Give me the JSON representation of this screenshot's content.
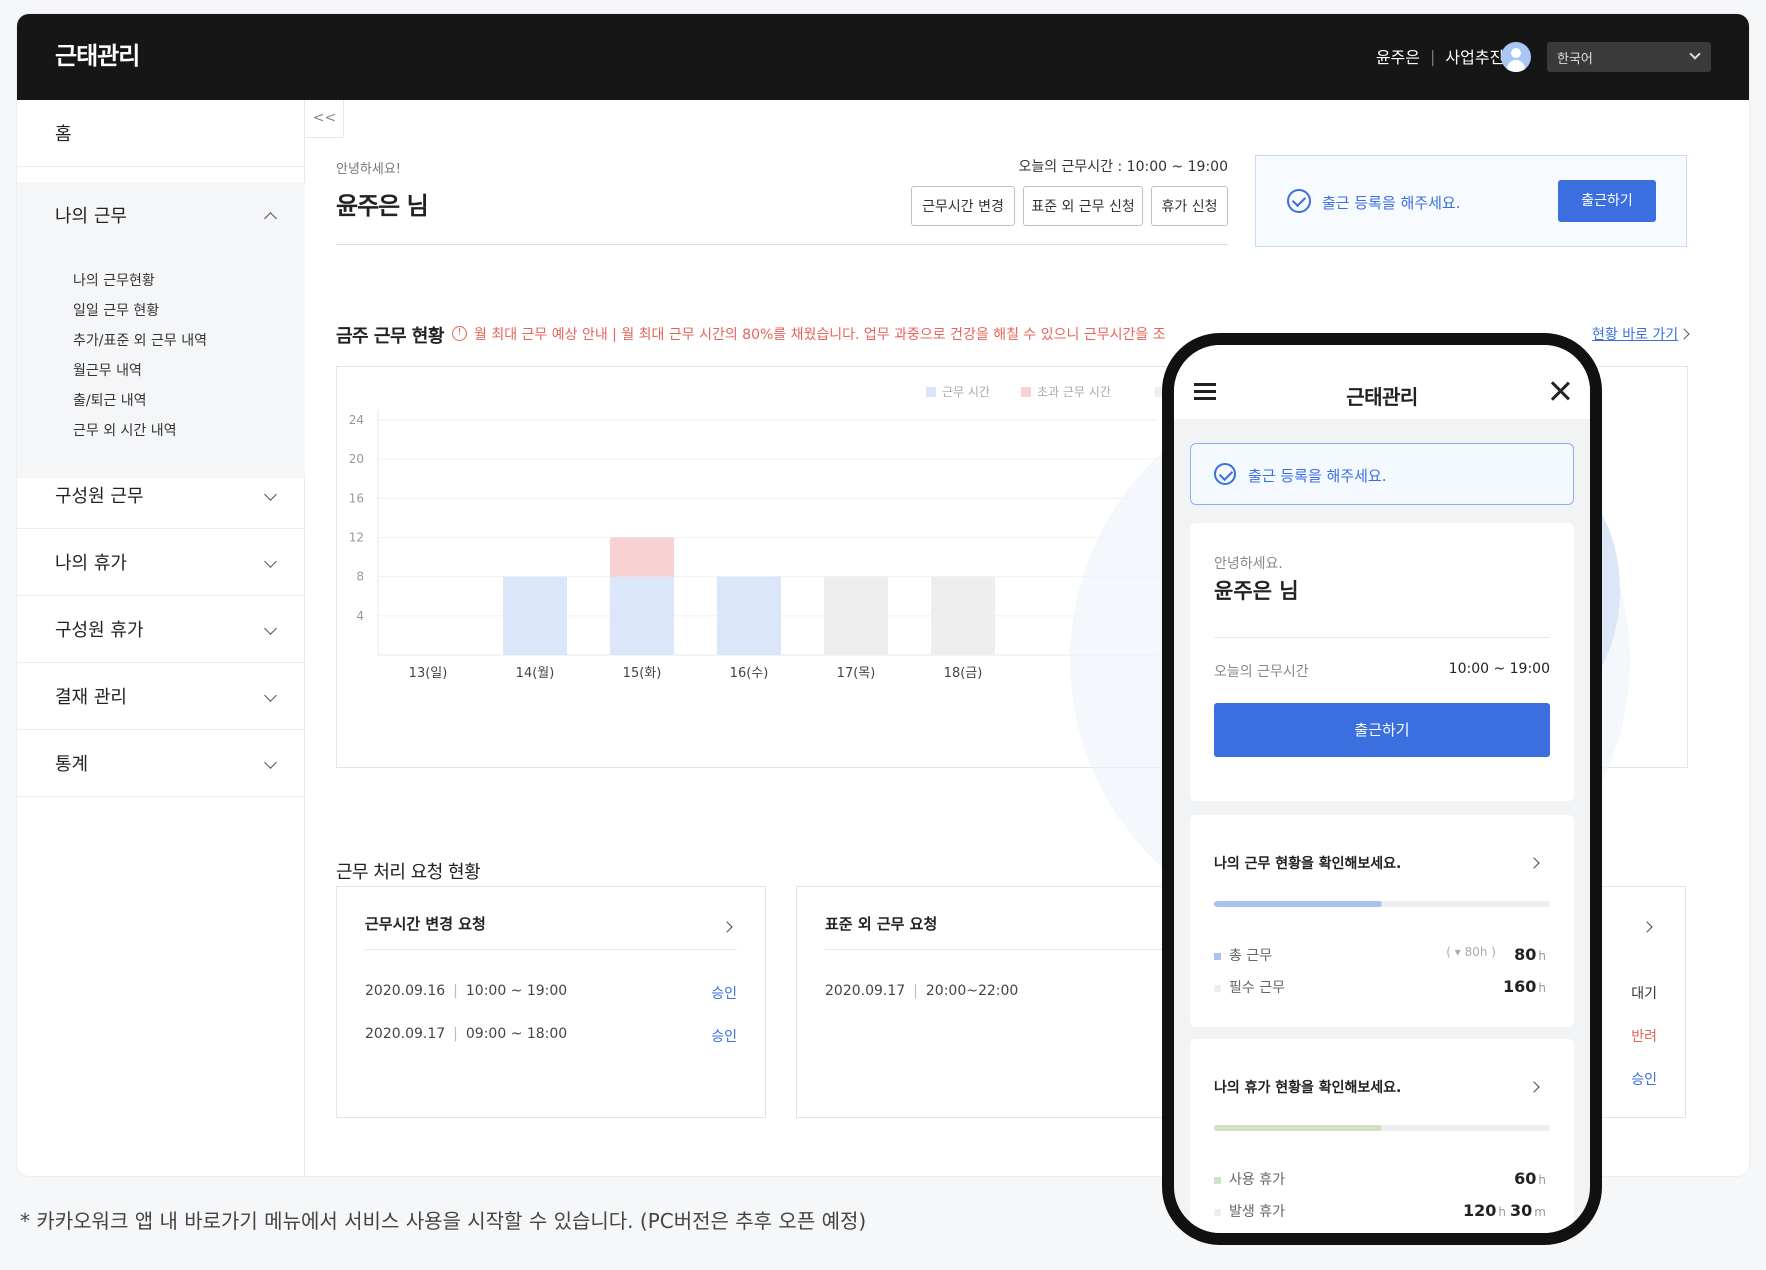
{
  "app": {
    "title": "근태관리"
  },
  "header": {
    "user_name": "윤주은",
    "department": "사업추진실",
    "language": "한국어"
  },
  "sidebar": {
    "home": "홈",
    "my_work": {
      "label": "나의 근무",
      "sub": [
        "나의 근무현황",
        "일일 근무 현황",
        "추가/표준 외 근무 내역",
        "월근무 내역",
        "출/퇴근 내역",
        "근무 외 시간 내역"
      ]
    },
    "members_work": "구성원 근무",
    "my_leave": "나의 휴가",
    "members_leave": "구성원 휴가",
    "approval": "결재 관리",
    "stats": "통계"
  },
  "collapse_label": "<<",
  "greeting": {
    "hello": "안녕하세요!",
    "name": "윤주은 님",
    "today_hours": "오늘의 근무시간 : 10:00 ~ 19:00"
  },
  "actions": {
    "change_hours": "근무시간 변경",
    "nonstandard": "표준 외 근무 신청",
    "leave": "휴가 신청"
  },
  "checkin": {
    "message": "출근 등록을 해주세요.",
    "button": "출근하기"
  },
  "week": {
    "title": "금주 근무 현황",
    "warning": "월 최대 근무 예상 안내 | 월 최대 근무 시간의 80%를 채웠습니다. 업무 과중으로 건강을 해칠 수 있으니 근무시간을 조",
    "link": "현황 바로 가기"
  },
  "chart_data": {
    "type": "bar",
    "categories": [
      "13(일)",
      "14(월)",
      "15(화)",
      "16(수)",
      "17(목)",
      "18(금)"
    ],
    "series": [
      {
        "name": "근무 시간",
        "values": [
          0,
          8,
          8,
          8,
          0,
          0
        ]
      },
      {
        "name": "초과 근무 시간",
        "values": [
          0,
          0,
          4,
          0,
          0,
          0
        ]
      },
      {
        "name": "",
        "values": [
          0,
          0,
          0,
          0,
          8,
          8
        ]
      }
    ],
    "yticks": [
      4,
      8,
      12,
      16,
      20,
      24
    ],
    "ylim": [
      0,
      24
    ],
    "legend": "top-right",
    "colors": [
      "#dbe6fb",
      "#f8d2d2",
      "#eeeeee"
    ]
  },
  "requests": {
    "title": "근무 처리 요청 현황",
    "card1": {
      "title": "근무시간 변경 요청",
      "rows": [
        {
          "date": "2020.09.16",
          "time": "10:00 ~ 19:00",
          "status": "승인"
        },
        {
          "date": "2020.09.17",
          "time": "09:00 ~ 18:00",
          "status": "승인"
        }
      ]
    },
    "card2": {
      "title": "표준 외 근무 요청",
      "rows": [
        {
          "date": "2020.09.17",
          "time": "20:00~22:00"
        }
      ]
    },
    "card3": {
      "statuses": [
        "대기",
        "반려",
        "승인"
      ]
    }
  },
  "footnote": "* 카카오워크 앱 내 바로가기 메뉴에서 서비스 사용을 시작할 수 있습니다. (PC버전은 추후 오픈 예정)",
  "mobile": {
    "title": "근태관리",
    "checkin_message": "출근 등록을 해주세요.",
    "hello": "안녕하세요.",
    "name": "윤주은 님",
    "today_label": "오늘의 근무시간",
    "today_hours": "10:00 ~ 19:00",
    "checkin_button": "출근하기",
    "work_card": {
      "title": "나의 근무 현황을 확인해보세요.",
      "progress": 0.5,
      "total_label": "총 근무",
      "total_hint": "( ▾ 80h )",
      "total_value": "80",
      "total_unit": "h",
      "required_label": "필수 근무",
      "required_value": "160",
      "required_unit": "h"
    },
    "leave_card": {
      "title": "나의 휴가 현황을 확인해보세요.",
      "progress": 0.5,
      "used_label": "사용 휴가",
      "used_value": "60",
      "used_unit": "h",
      "issued_label": "발생 휴가",
      "issued_value": "120",
      "issued_unit": "h",
      "issued_value2": "30",
      "issued_unit2": "m"
    }
  }
}
